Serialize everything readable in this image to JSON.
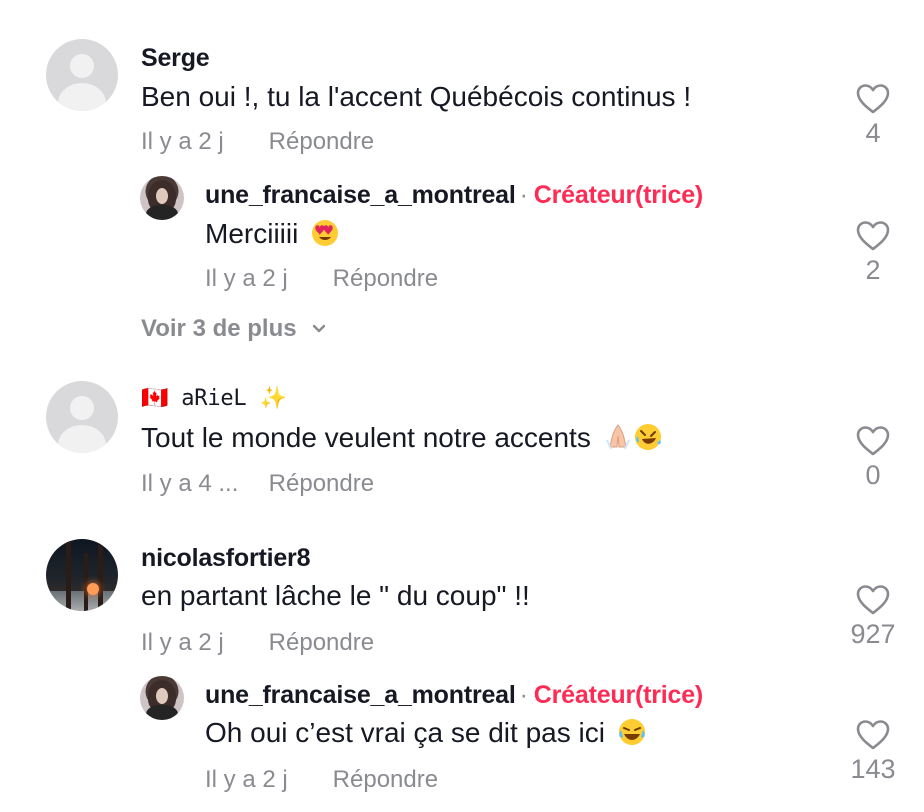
{
  "top_fragment": "",
  "comments": [
    {
      "username": "Serge",
      "text": "Ben oui !, tu la l'accent Québécois continus !",
      "time": "Il y a 2 j",
      "reply": "Répondre",
      "likes": "4"
    },
    {
      "username": "une_francaise_a_montreal",
      "separator": "·",
      "badge": "Créateur(trice)",
      "text": "Merciiiii",
      "time": "Il y a 2 j",
      "reply": "Répondre",
      "likes": "2",
      "emoji": "heart-eyes-emoji"
    },
    {
      "username": "🇨🇦 aRieL ✨",
      "text": "Tout le monde veulent notre accents",
      "time": "Il y a 4 ...",
      "reply": "Répondre",
      "likes": "0",
      "emoji": [
        "folded-hands-emoji",
        "rolling-laughing-emoji"
      ]
    },
    {
      "username": "nicolasfortier8",
      "text": "en partant lâche le \" du coup\" !!",
      "time": "Il y a 2 j",
      "reply": "Répondre",
      "likes": "927"
    },
    {
      "username": "une_francaise_a_montreal",
      "separator": "·",
      "badge": "Créateur(trice)",
      "text": "Oh oui c’est vrai ça se dit pas ici",
      "time": "Il y a 2 j",
      "reply": "Répondre",
      "likes": "143",
      "emoji": "laughing-tears-emoji"
    }
  ],
  "view_more": "Voir 3 de plus",
  "colors": {
    "text": "#161823",
    "secondary": "#8a8b91",
    "creator_badge": "#fe2c55",
    "background": "#ffffff"
  },
  "icons": {
    "like": "heart-outline-icon",
    "expand": "chevron-down-icon"
  }
}
